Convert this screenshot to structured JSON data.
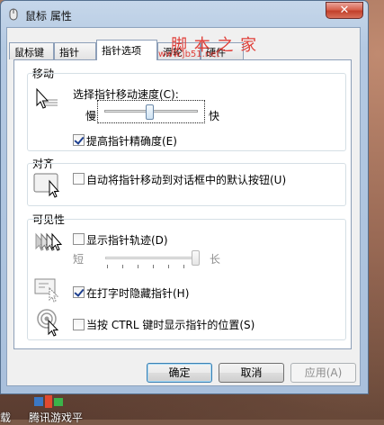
{
  "window": {
    "title": "鼠标 属性",
    "close_label": "✕"
  },
  "tabs": [
    {
      "label": "鼠标键"
    },
    {
      "label": "指针"
    },
    {
      "label": "指针选项"
    },
    {
      "label": "滑轮"
    },
    {
      "label": "硬件"
    }
  ],
  "watermark": {
    "line1": "脚 本 之 家",
    "line2": "www.jb51.net"
  },
  "motion": {
    "group_label": "移动",
    "speed_label": "选择指针移动速度(C):",
    "slow_label": "慢",
    "fast_label": "快",
    "speed_fraction": 0.5,
    "precision_label": "提高指针精确度(E)",
    "precision_checked": true
  },
  "snap": {
    "group_label": "对齐",
    "snap_label": "自动将指针移动到对话框中的默认按钮(U)",
    "snap_checked": false
  },
  "visibility": {
    "group_label": "可见性",
    "trails_label": "显示指针轨迹(D)",
    "trails_checked": false,
    "short_label": "短",
    "long_label": "长",
    "trails_fraction": 1.0,
    "hide_label": "在打字时隐藏指针(H)",
    "hide_checked": true,
    "ctrl_label": "当按 CTRL 键时显示指针的位置(S)",
    "ctrl_checked": false
  },
  "buttons": {
    "ok": "确定",
    "cancel": "取消",
    "apply": "应用(A)"
  },
  "taskbar": {
    "item1": "载",
    "item2": "腾讯游戏平"
  }
}
